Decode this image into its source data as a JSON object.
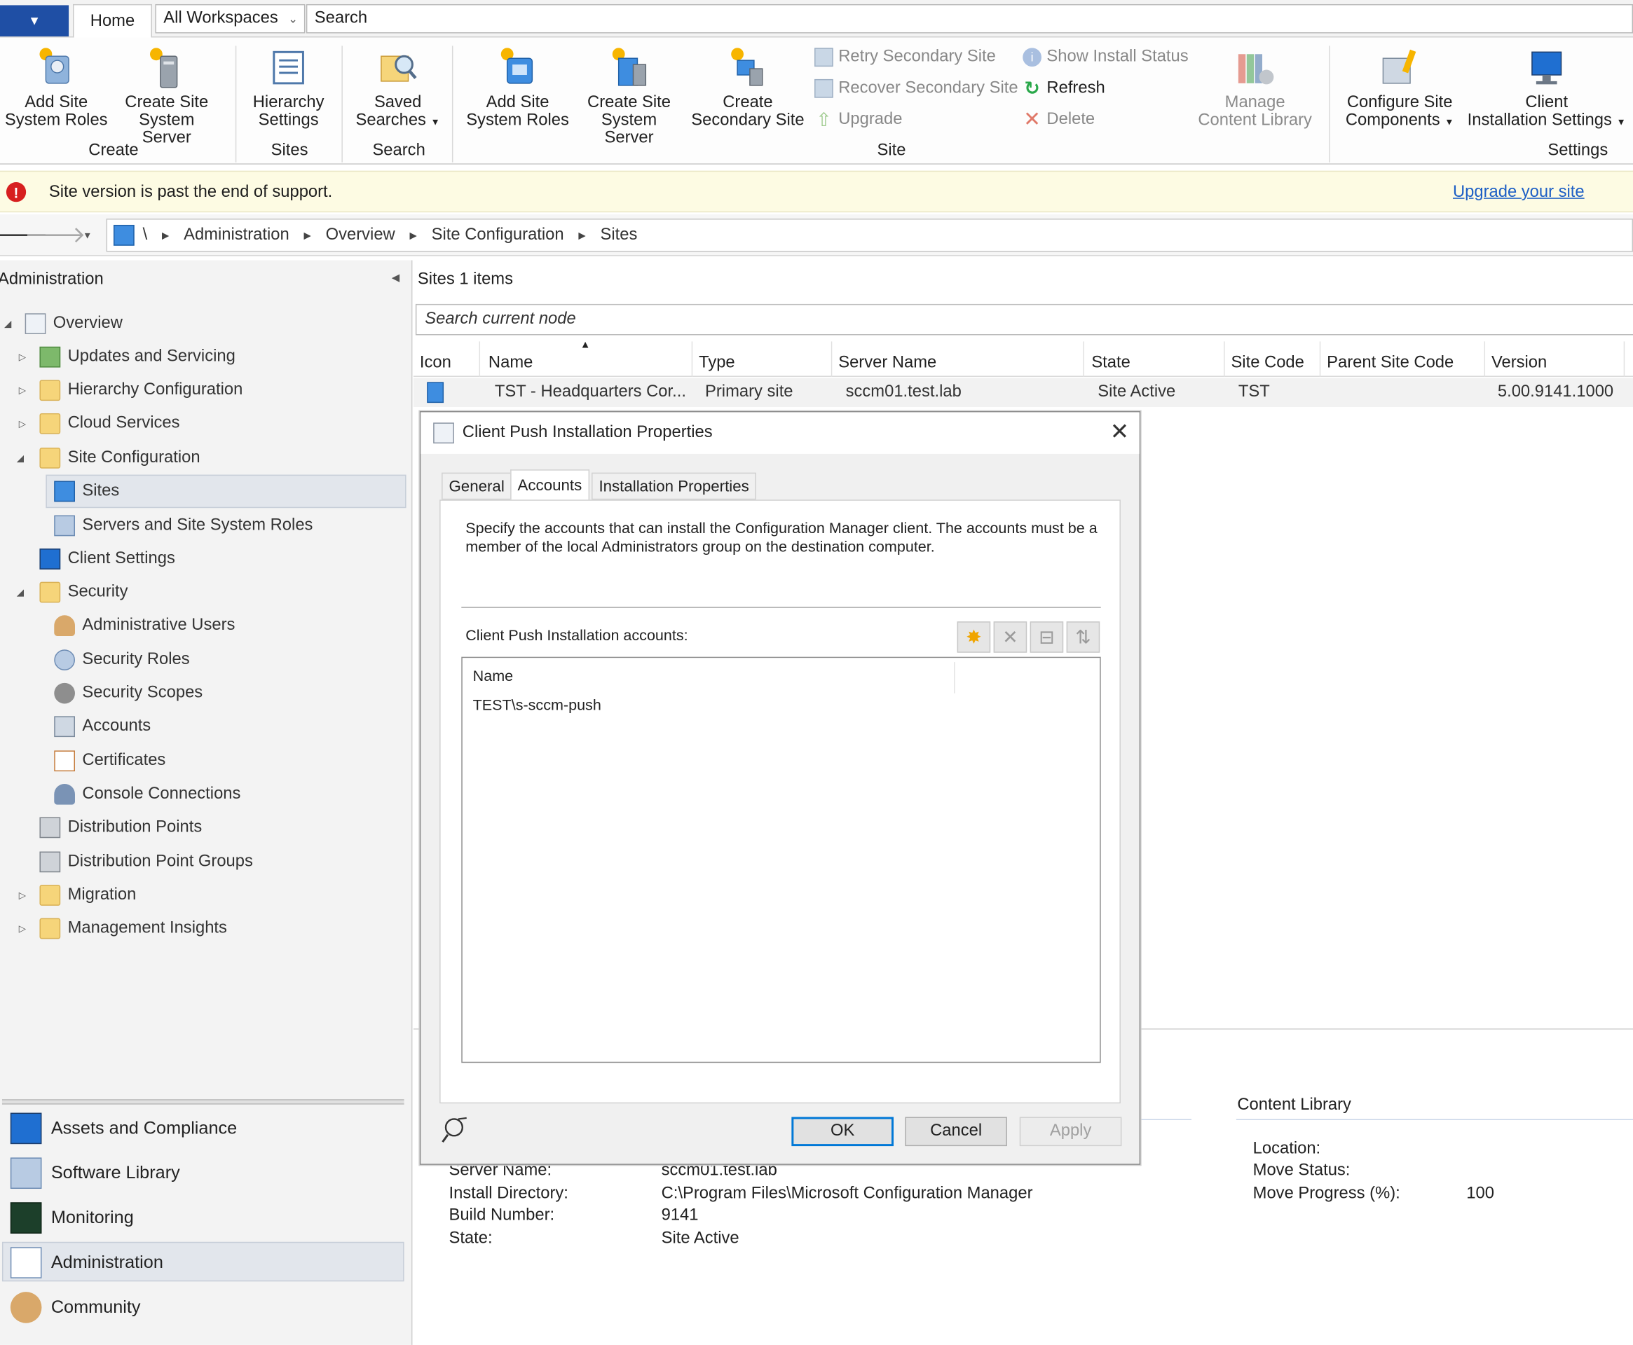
{
  "tabs": {
    "home": "Home",
    "workspaces": "All Workspaces",
    "search": "Search"
  },
  "ribbon": {
    "create": {
      "label": "Create",
      "add_site_system_roles": [
        "Add Site",
        "System Roles"
      ],
      "create_site_system_server": [
        "Create Site",
        "System Server"
      ]
    },
    "sites": {
      "label": "Sites",
      "hierarchy_settings": [
        "Hierarchy",
        "Settings"
      ]
    },
    "search": {
      "label": "Search",
      "saved_searches": [
        "Saved",
        "Searches"
      ]
    },
    "site": {
      "label": "Site",
      "add_site_system_roles": [
        "Add Site",
        "System Roles"
      ],
      "create_site_system_server": [
        "Create Site",
        "System Server"
      ],
      "create_secondary_site": [
        "Create",
        "Secondary Site"
      ],
      "retry_secondary_site": "Retry Secondary Site",
      "recover_secondary_site": "Recover Secondary Site",
      "upgrade": "Upgrade",
      "show_install_status": "Show Install Status",
      "refresh": "Refresh",
      "delete": "Delete",
      "manage_content_library": [
        "Manage",
        "Content Library"
      ]
    },
    "settings": {
      "label": "Settings",
      "configure_site_components": [
        "Configure Site",
        "Components"
      ],
      "client_installation_settings": [
        "Client",
        "Installation Settings"
      ]
    }
  },
  "banner": {
    "message": "Site version is past the end of support.",
    "link": "Upgrade your site"
  },
  "breadcrumb": {
    "root": "\\",
    "items": [
      "Administration",
      "Overview",
      "Site Configuration",
      "Sites"
    ]
  },
  "nav": {
    "title": "Administration",
    "items": [
      "Overview",
      "Updates and Servicing",
      "Hierarchy Configuration",
      "Cloud Services",
      "Site Configuration",
      "Sites",
      "Servers and Site System Roles",
      "Client Settings",
      "Security",
      "Administrative Users",
      "Security Roles",
      "Security Scopes",
      "Accounts",
      "Certificates",
      "Console Connections",
      "Distribution Points",
      "Distribution Point Groups",
      "Migration",
      "Management Insights"
    ],
    "workspaces": [
      "Assets and Compliance",
      "Software Library",
      "Monitoring",
      "Administration",
      "Community"
    ]
  },
  "main": {
    "header": "Sites 1 items",
    "search_placeholder": "Search current node",
    "columns": [
      "Icon",
      "Name",
      "Type",
      "Server Name",
      "State",
      "Site Code",
      "Parent Site Code",
      "Version"
    ],
    "row": {
      "name": "TST - Headquarters Cor...",
      "type": "Primary site",
      "server": "sccm01.test.lab",
      "state": "Site Active",
      "code": "TST",
      "parent": "",
      "version": "5.00.9141.1000"
    }
  },
  "details": {
    "server_name_label": "Server Name:",
    "server_name_value": "sccm01.test.lab",
    "install_dir_label": "Install Directory:",
    "install_dir_value": "C:\\Program Files\\Microsoft Configuration Manager",
    "build_label": "Build Number:",
    "build_value": "9141",
    "state_label": "State:",
    "state_value": "Site Active",
    "content_library": {
      "title": "Content Library",
      "location_label": "Location:",
      "move_status_label": "Move Status:",
      "move_progress_label": "Move Progress (%):",
      "move_progress_value": "100"
    }
  },
  "dialog": {
    "title": "Client Push Installation Properties",
    "tabs": [
      "General",
      "Accounts",
      "Installation Properties"
    ],
    "description": "Specify the accounts that can install the Configuration Manager client. The accounts must be a member of the local Administrators group on the destination computer.",
    "accounts_label": "Client Push Installation accounts:",
    "list_header": "Name",
    "accounts": [
      "TEST\\s-sccm-push"
    ],
    "buttons": {
      "ok": "OK",
      "cancel": "Cancel",
      "apply": "Apply"
    }
  }
}
